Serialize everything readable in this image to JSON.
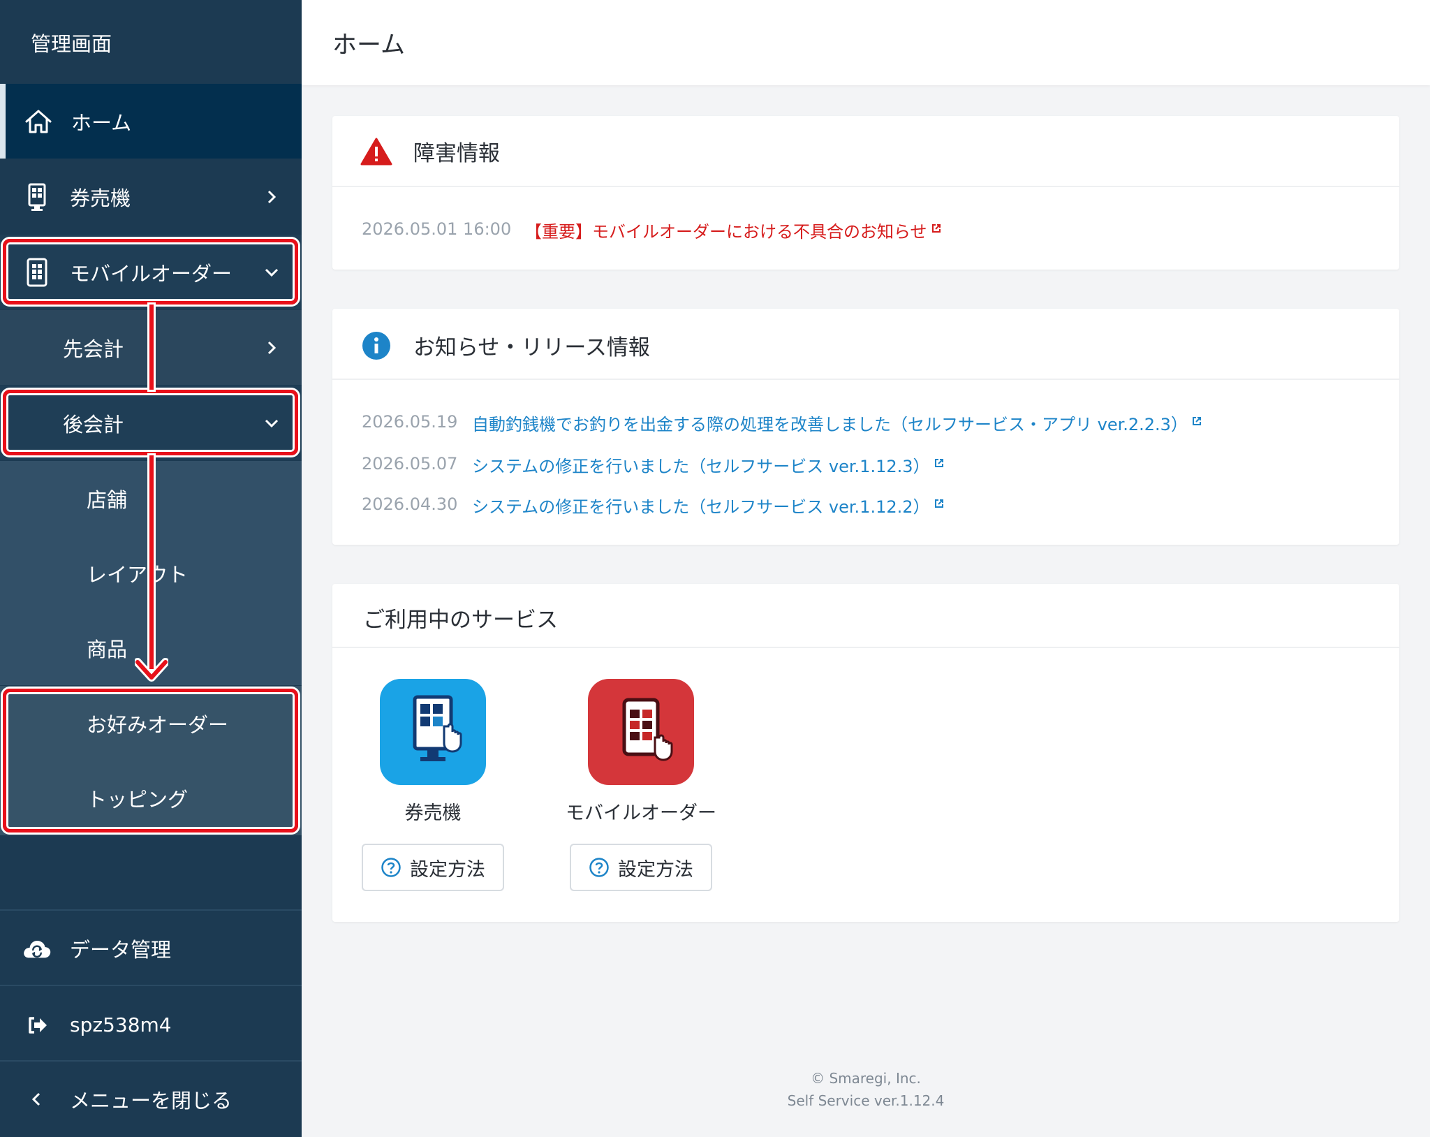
{
  "sidebar": {
    "title": "管理画面",
    "items": [
      {
        "label": "ホーム",
        "icon": "home-icon"
      },
      {
        "label": "券売機",
        "icon": "kiosk-icon"
      },
      {
        "label": "モバイルオーダー",
        "icon": "tablet-icon"
      },
      {
        "label": "先会計"
      },
      {
        "label": "後会計"
      },
      {
        "label": "店舗"
      },
      {
        "label": "レイアウト"
      },
      {
        "label": "商品"
      },
      {
        "label": "お好みオーダー"
      },
      {
        "label": "トッピング"
      }
    ],
    "data_mgmt": "データ管理",
    "account": "spz538m4",
    "close_menu": "メニューを閉じる"
  },
  "header": {
    "title": "ホーム"
  },
  "incident": {
    "title": "障害情報",
    "rows": [
      {
        "date": "2026.05.01 16:00",
        "text": "【重要】モバイルオーダーにおける不具合のお知らせ"
      }
    ]
  },
  "news": {
    "title": "お知らせ・リリース情報",
    "rows": [
      {
        "date": "2026.05.19",
        "text": "自動釣銭機でお釣りを出金する際の処理を改善しました（セルフサービス・アプリ ver.2.2.3）"
      },
      {
        "date": "2026.05.07",
        "text": "システムの修正を行いました（セルフサービス ver.1.12.3）"
      },
      {
        "date": "2026.04.30",
        "text": "システムの修正を行いました（セルフサービス ver.1.12.2）"
      }
    ]
  },
  "services": {
    "title": "ご利用中のサービス",
    "items": [
      {
        "name": "券売機",
        "button": "設定方法",
        "color": "#1aa3e6"
      },
      {
        "name": "モバイルオーダー",
        "button": "設定方法",
        "color": "#d4363a"
      }
    ]
  },
  "footer": {
    "copyright": "© Smaregi, Inc.",
    "version": "Self Service ver.1.12.4"
  },
  "colors": {
    "sidebar": "#1c3a52",
    "accent_red": "#e8101a",
    "link_blue": "#1d84c8"
  }
}
